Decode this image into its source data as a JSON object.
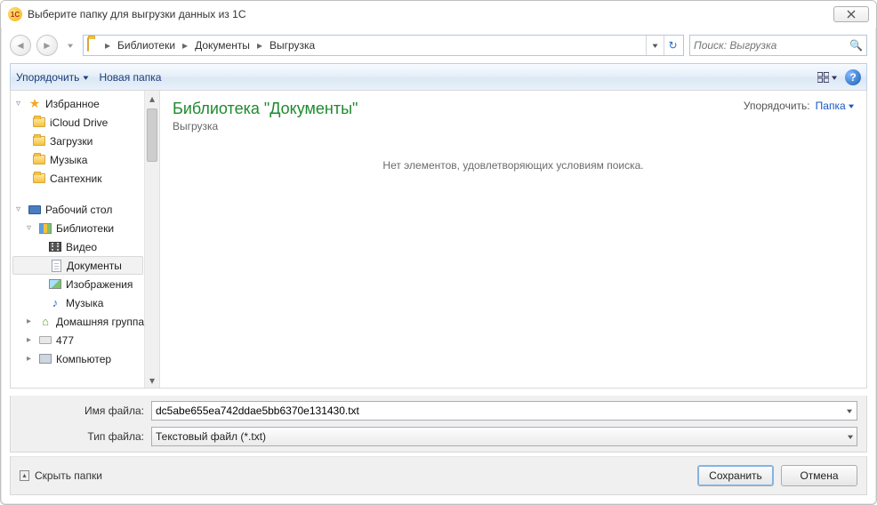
{
  "window": {
    "title": "Выберите папку для выгрузки данных из 1С"
  },
  "nav": {
    "crumbs": [
      "Библиотеки",
      "Документы",
      "Выгрузка"
    ],
    "search_placeholder": "Поиск: Выгрузка"
  },
  "toolbar": {
    "organize": "Упорядочить",
    "new_folder": "Новая папка"
  },
  "tree": {
    "favorites": "Избранное",
    "fav_items": [
      "iCloud Drive",
      "Загрузки",
      "Музыка",
      "Сантехник"
    ],
    "desktop": "Рабочий стол",
    "libraries": "Библиотеки",
    "lib_items": [
      "Видео",
      "Документы",
      "Изображения",
      "Музыка"
    ],
    "homegroup": "Домашняя группа",
    "drive": "477",
    "computer": "Компьютер",
    "selected": "Документы"
  },
  "content": {
    "lib_title": "Библиотека \"Документы\"",
    "lib_sub": "Выгрузка",
    "sort_label": "Упорядочить:",
    "sort_value": "Папка",
    "empty_msg": "Нет элементов, удовлетворяющих условиям поиска."
  },
  "bottom": {
    "filename_label": "Имя файла:",
    "filename_value": "dc5abe655ea742ddae5bb6370e131430.txt",
    "filetype_label": "Тип файла:",
    "filetype_value": "Текстовый файл (*.txt)"
  },
  "footer": {
    "hide_folders": "Скрыть папки",
    "save": "Сохранить",
    "cancel": "Отмена"
  }
}
